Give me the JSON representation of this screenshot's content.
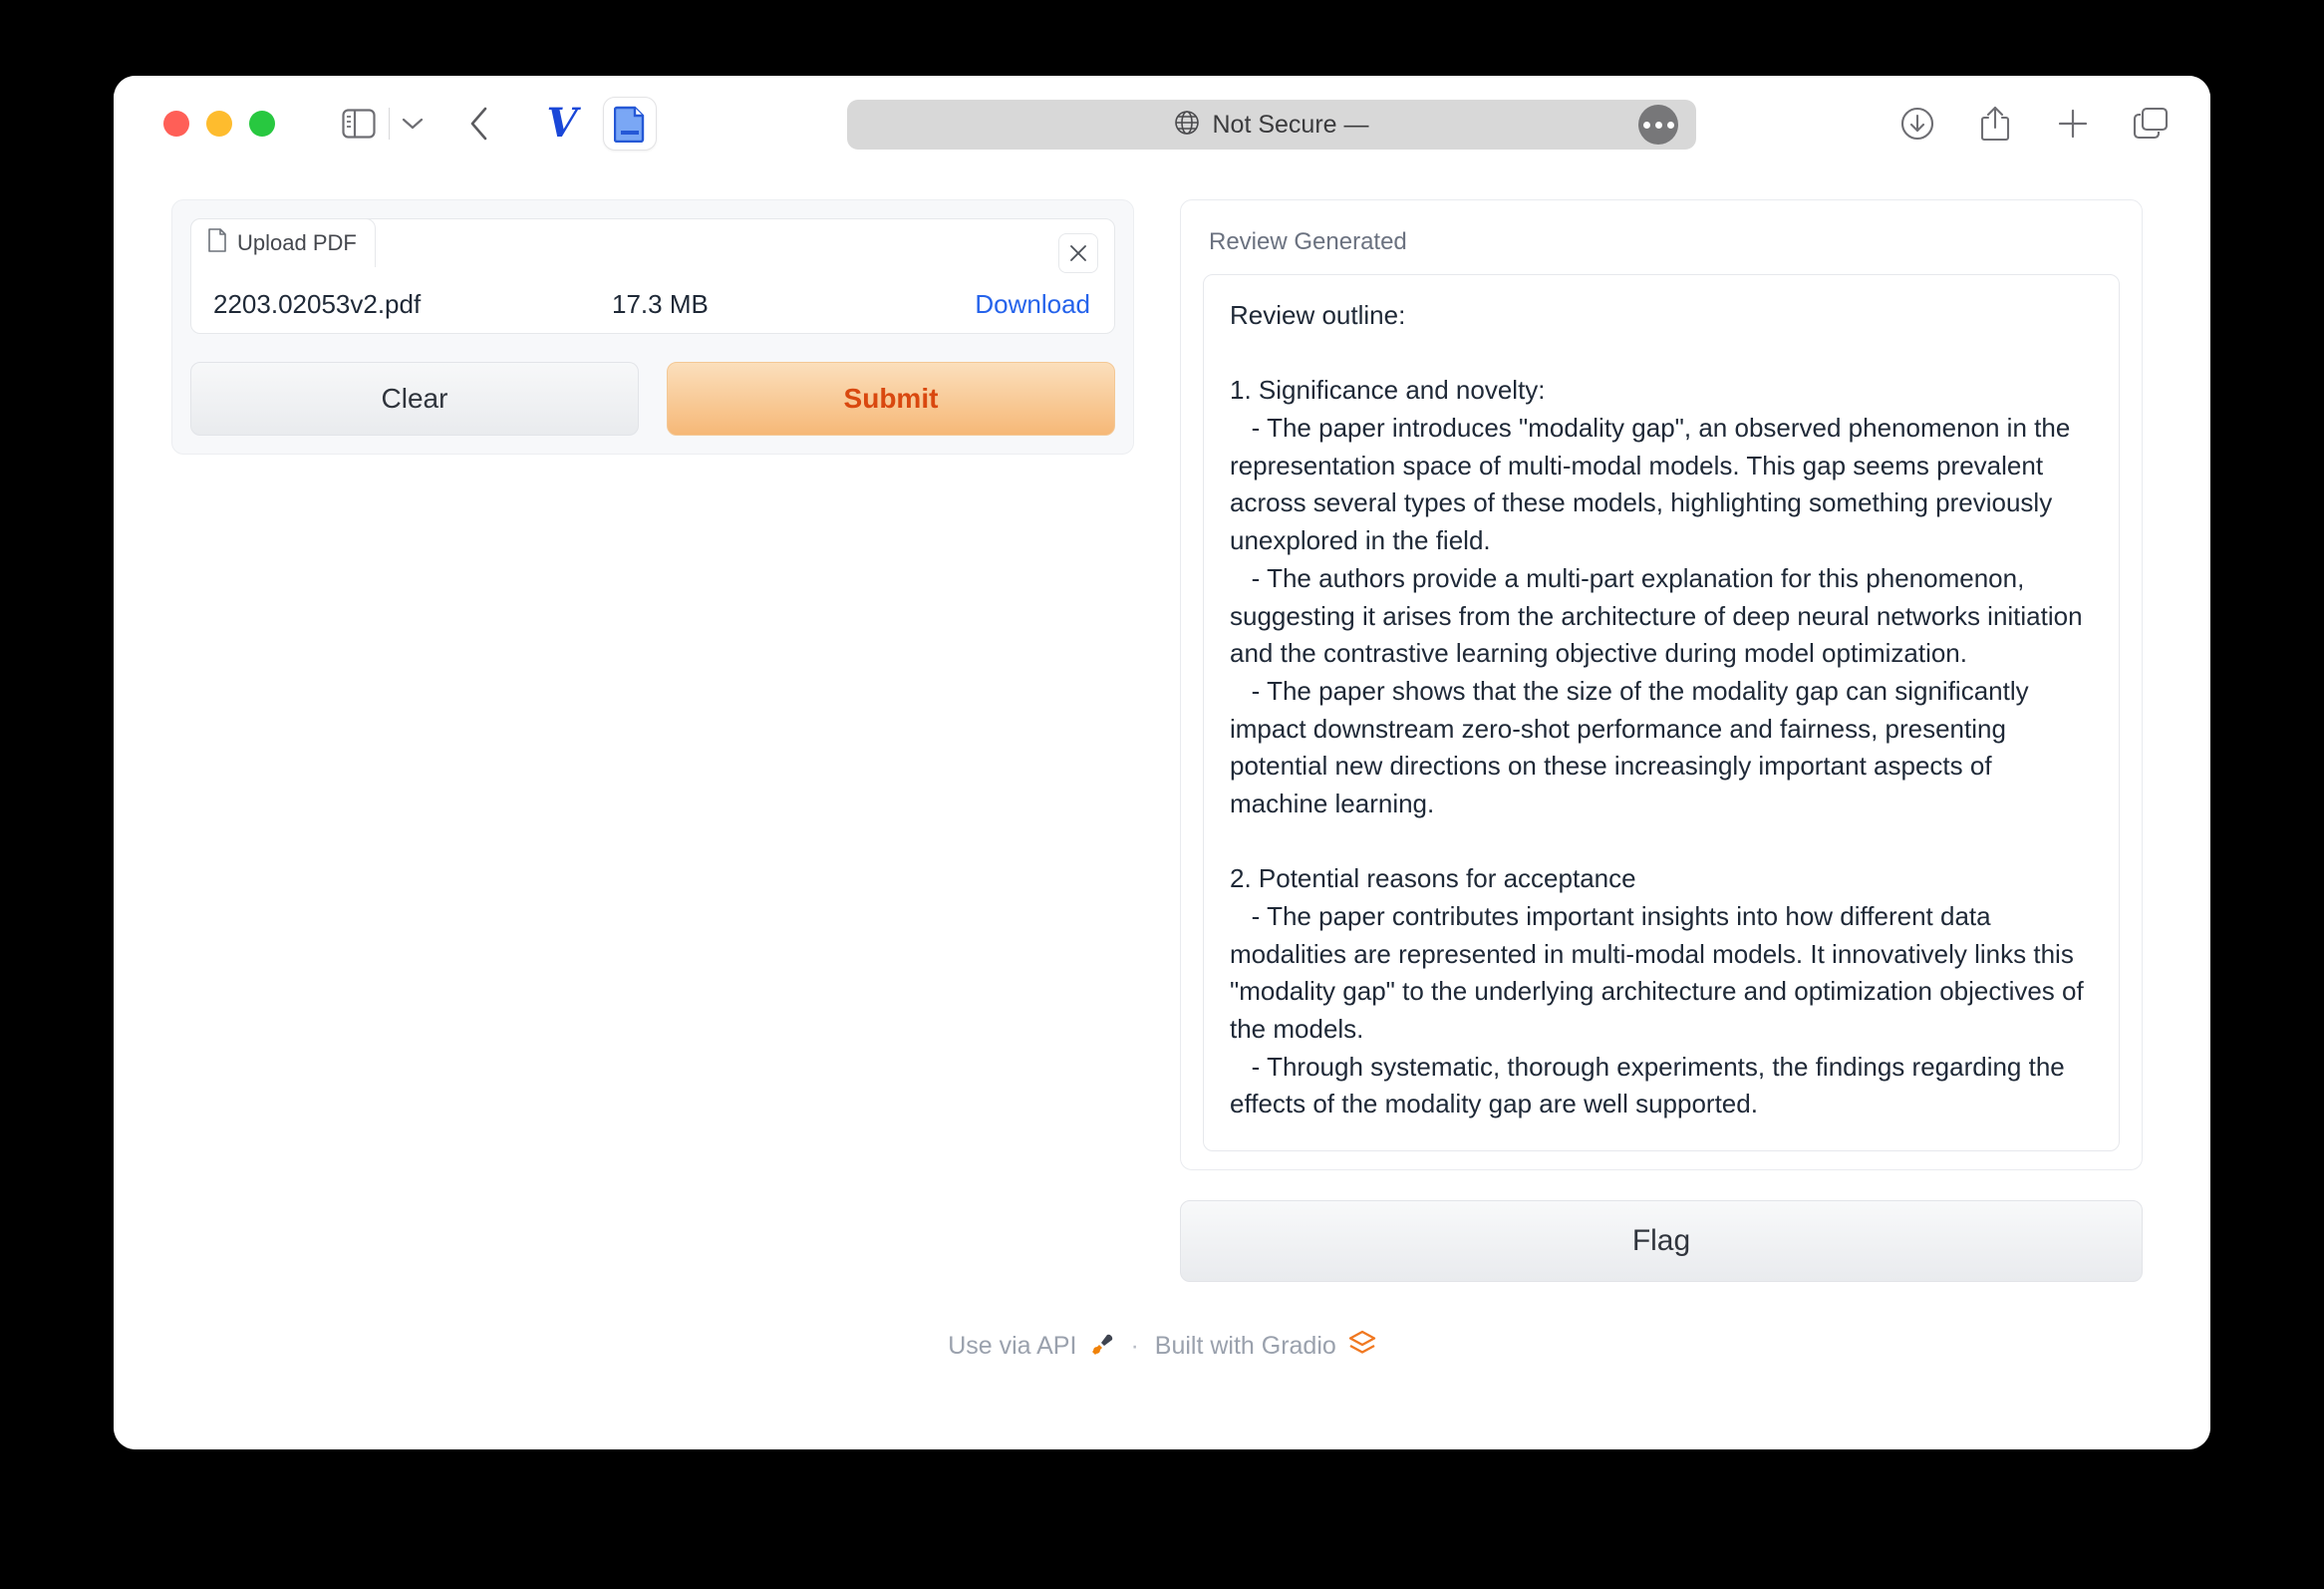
{
  "browser": {
    "url_bar": {
      "security_text": "Not Secure —",
      "globe_icon": "globe-icon",
      "more_icon": "ellipsis-icon"
    },
    "tabs": [
      {
        "favicon": "vercel-v-icon",
        "label": "V"
      },
      {
        "favicon": "document-icon",
        "label": ""
      }
    ],
    "controls": {
      "sidebar_icon": "sidebar-toggle-icon",
      "dropdown_icon": "chevron-down-icon",
      "back_icon": "chevron-left-icon",
      "downloads_icon": "download-circle-icon",
      "share_icon": "share-icon",
      "new_tab_icon": "plus-icon",
      "tab_overview_icon": "tab-overview-icon"
    }
  },
  "upload": {
    "tab_label": "Upload PDF",
    "tab_icon": "file-icon",
    "close_icon": "close-icon",
    "file_name": "2203.02053v2.pdf",
    "file_size": "17.3 MB",
    "download_label": "Download",
    "clear_label": "Clear",
    "submit_label": "Submit",
    "submit_color": "#d9480f"
  },
  "review": {
    "label": "Review Generated",
    "flag_label": "Flag",
    "text": "Review outline:\n\n1. Significance and novelty:\n   - The paper introduces \"modality gap\", an observed phenomenon in the representation space of multi-modal models. This gap seems prevalent across several types of these models, highlighting something previously unexplored in the field.\n   - The authors provide a multi-part explanation for this phenomenon, suggesting it arises from the architecture of deep neural networks initiation and the contrastive learning objective during model optimization.\n   - The paper shows that the size of the modality gap can significantly impact downstream zero-shot performance and fairness, presenting potential new directions on these increasingly important aspects of machine learning.\n\n2. Potential reasons for acceptance\n   - The paper contributes important insights into how different data modalities are represented in multi-modal models. It innovatively links this \"modality gap\" to the underlying architecture and optimization objectives of the models.\n   - Through systematic, thorough experiments, the findings regarding the effects of the modality gap are well supported."
  },
  "footer": {
    "api_label": "Use via API",
    "api_icon": "plug-icon",
    "separator": "·",
    "gradio_label": "Built with Gradio",
    "gradio_icon": "gradio-logo-icon"
  }
}
